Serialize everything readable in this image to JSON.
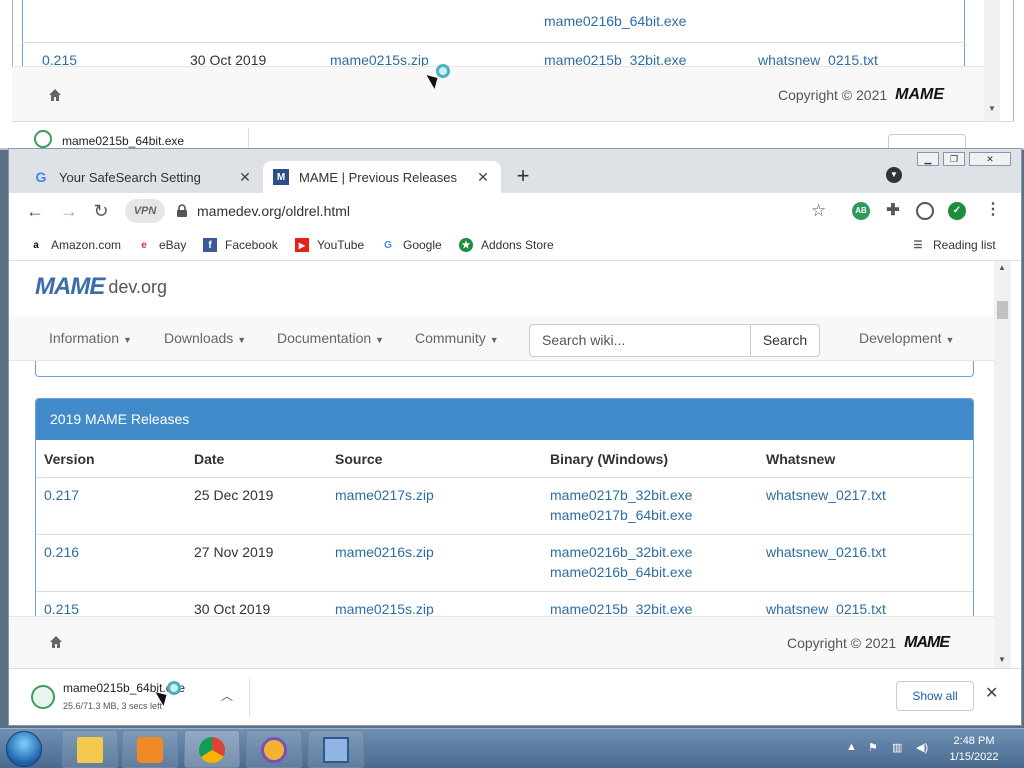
{
  "bg_window": {
    "rows": [
      {
        "version": "",
        "date": "",
        "source": "",
        "bin32": "mame0216b_64bit.exe",
        "whatsnew": ""
      },
      {
        "version": "0.215",
        "date": "30 Oct 2019",
        "source": "mame0215s.zip",
        "bin32": "mame0215b_32bit.exe",
        "whatsnew": "whatsnew_0215.txt"
      }
    ],
    "copyright": "Copyright © 2021",
    "footer_logo": "MAME",
    "download_name": "mame0215b_64bit.exe"
  },
  "browser": {
    "tabs": [
      {
        "title": "Your SafeSearch Setting",
        "favicon": "G"
      },
      {
        "title": "MAME | Previous Releases",
        "favicon": "M"
      }
    ],
    "vpn_label": "VPN",
    "url": "mamedev.org/oldrel.html",
    "ext_ab": "AB",
    "bookmarks": [
      {
        "label": "Amazon.com",
        "icon": "a"
      },
      {
        "label": "eBay",
        "icon": "e"
      },
      {
        "label": "Facebook",
        "icon": "f"
      },
      {
        "label": "YouTube",
        "icon": "▶"
      },
      {
        "label": "Google",
        "icon": "G"
      },
      {
        "label": "Addons Store",
        "icon": "★"
      }
    ],
    "reading_list": "Reading list"
  },
  "site": {
    "logo_mame": "MAME",
    "logo_dev": "dev.org",
    "nav": {
      "information": "Information",
      "downloads": "Downloads",
      "documentation": "Documentation",
      "community": "Community",
      "development": "Development"
    },
    "search_placeholder": "Search wiki...",
    "search_button": "Search",
    "panel_title": "2019 MAME Releases",
    "columns": {
      "version": "Version",
      "date": "Date",
      "source": "Source",
      "binary": "Binary (Windows)",
      "whatsnew": "Whatsnew"
    },
    "releases": [
      {
        "version": "0.217",
        "date": "25 Dec 2019",
        "source": "mame0217s.zip",
        "bin32": "mame0217b_32bit.exe",
        "bin64": "mame0217b_64bit.exe",
        "whatsnew": "whatsnew_0217.txt"
      },
      {
        "version": "0.216",
        "date": "27 Nov 2019",
        "source": "mame0216s.zip",
        "bin32": "mame0216b_32bit.exe",
        "bin64": "mame0216b_64bit.exe",
        "whatsnew": "whatsnew_0216.txt"
      },
      {
        "version": "0.215",
        "date": "30 Oct 2019",
        "source": "mame0215s.zip",
        "bin32": "mame0215b_32bit.exe",
        "bin64": "",
        "whatsnew": "whatsnew_0215.txt"
      }
    ],
    "copyright": "Copyright © 2021",
    "footer_logo": "MAME"
  },
  "download": {
    "filename": "mame0215b_64bit.exe",
    "status": "25.6/71.3 MB, 3 secs left",
    "show_all": "Show all"
  },
  "taskbar": {
    "time": "2:48 PM",
    "date": "1/15/2022"
  },
  "colors": {
    "accent": "#428bca",
    "link": "#2e6da4",
    "panel_border": "#6fa0d8"
  }
}
